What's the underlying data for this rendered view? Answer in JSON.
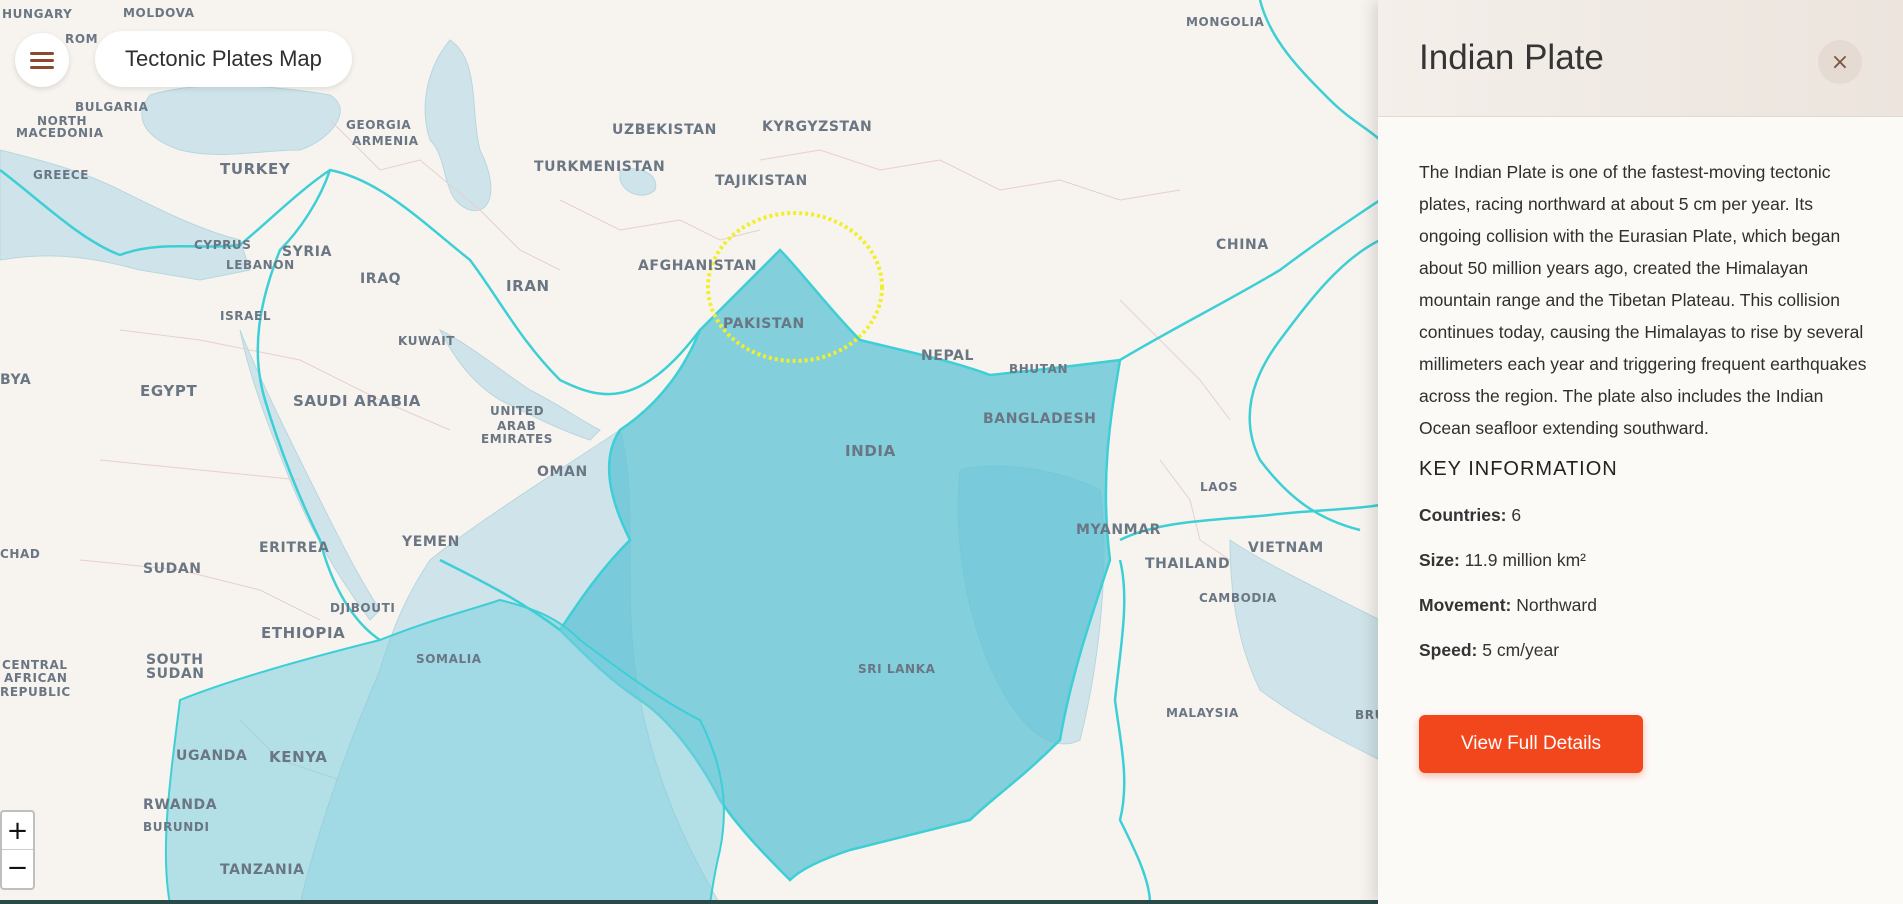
{
  "header": {
    "title": "Tectonic Plates Map"
  },
  "icons": {
    "menu": "hamburger-menu-icon",
    "close": "close-icon",
    "zoom_in": "plus-icon",
    "zoom_out": "minus-icon"
  },
  "colors": {
    "plate_fill": "#5cc3d6",
    "plate_border": "#3ecfd6",
    "highlight_ring": "#f1ee2a",
    "accent_button": "#f2461d"
  },
  "zoom": {
    "in_label": "+",
    "out_label": "−"
  },
  "map": {
    "labels": {
      "hungary": "HUNGARY",
      "moldova": "MOLDOVA",
      "rom": "ROM",
      "mongolia": "MONGOLIA",
      "bulgaria": "BULGARIA",
      "north": "NORTH",
      "macedonia": "MACEDONIA",
      "georgia": "GEORGIA",
      "armenia": "ARMENIA",
      "uzbekistan": "UZBEKISTAN",
      "kyrgyzstan": "KYRGYZSTAN",
      "turkey": "TURKEY",
      "greece": "GREECE",
      "turkmenistan": "TURKMENISTAN",
      "tajikistan": "TAJIKISTAN",
      "cyprus": "CYPRUS",
      "syria": "SYRIA",
      "lebanon": "LEBANON",
      "afghanistan": "AFGHANISTAN",
      "china": "CHINA",
      "iraq": "IRAQ",
      "iran": "IRAN",
      "israel": "ISRAEL",
      "pakistan": "PAKISTAN",
      "kuwait": "KUWAIT",
      "bya": "BYA",
      "egypt": "EGYPT",
      "saudi_arabia": "SAUDI ARABIA",
      "nepal": "NEPAL",
      "bhutan": "BHUTAN",
      "united": "UNITED",
      "arab": "ARAB",
      "emirates": "EMIRATES",
      "bangladesh": "BANGLADESH",
      "india": "INDIA",
      "oman": "OMAN",
      "laos": "LAOS",
      "chad": "CHAD",
      "eritrea": "ERITREA",
      "yemen": "YEMEN",
      "myanmar": "MYANMAR",
      "vietnam": "VIETNAM",
      "sudan": "SUDAN",
      "thailand": "THAILAND",
      "djibouti": "DJIBOUTI",
      "ethiopia": "ETHIOPIA",
      "cambodia": "CAMBODIA",
      "somalia": "SOMALIA",
      "central": "CENTRAL",
      "african": "AFRICAN",
      "republic": "REPUBLIC",
      "south": "SOUTH",
      "south_sudan": "SUDAN",
      "sri_lanka": "SRI LANKA",
      "malaysia": "MALAYSIA",
      "bru": "BRU",
      "uganda": "UGANDA",
      "kenya": "KENYA",
      "rwanda": "RWANDA",
      "burundi": "BURUNDI",
      "tanzania": "TANZANIA"
    }
  },
  "panel": {
    "title": "Indian Plate",
    "close_label": "×",
    "description": "The Indian Plate is one of the fastest-moving tectonic plates, racing northward at about 5 cm per year. Its ongoing collision with the Eurasian Plate, which began about 50 million years ago, created the Himalayan mountain range and the Tibetan Plateau. This collision continues today, causing the Himalayas to rise by several millimeters each year and triggering frequent earthquakes across the region. The plate also includes the Indian Ocean seafloor extending southward.",
    "section_title": "KEY INFORMATION",
    "info": [
      {
        "label": "Countries:",
        "value": "6"
      },
      {
        "label": "Size:",
        "value": "11.9 million km²"
      },
      {
        "label": "Movement:",
        "value": "Northward"
      },
      {
        "label": "Speed:",
        "value": "5 cm/year"
      }
    ],
    "button_label": "View Full Details"
  }
}
